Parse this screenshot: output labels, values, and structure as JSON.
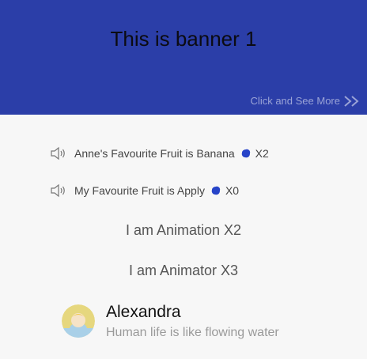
{
  "banner": {
    "title": "This is banner 1",
    "more_label": "Click and See More",
    "more_icon": "double-chevron-right-icon",
    "background": "#2b3ea8"
  },
  "fruit_rows": [
    {
      "icon": "speaker-icon",
      "text": "Anne's Favourite Fruit is Banana",
      "badge_icon": "blue-blob-icon",
      "count": "X2"
    },
    {
      "icon": "speaker-icon",
      "text": "My Favourite Fruit is Apply",
      "badge_icon": "blue-blob-icon",
      "count": "X0"
    }
  ],
  "animations": [
    {
      "text": "I am Animation X2"
    },
    {
      "text": "I am Animator X3"
    }
  ],
  "profile": {
    "name": "Alexandra",
    "subtitle": "Human life is like flowing water",
    "avatar_icon": "avatar-icon"
  },
  "colors": {
    "accent": "#2b3ea8",
    "blob": "#2744c8"
  }
}
